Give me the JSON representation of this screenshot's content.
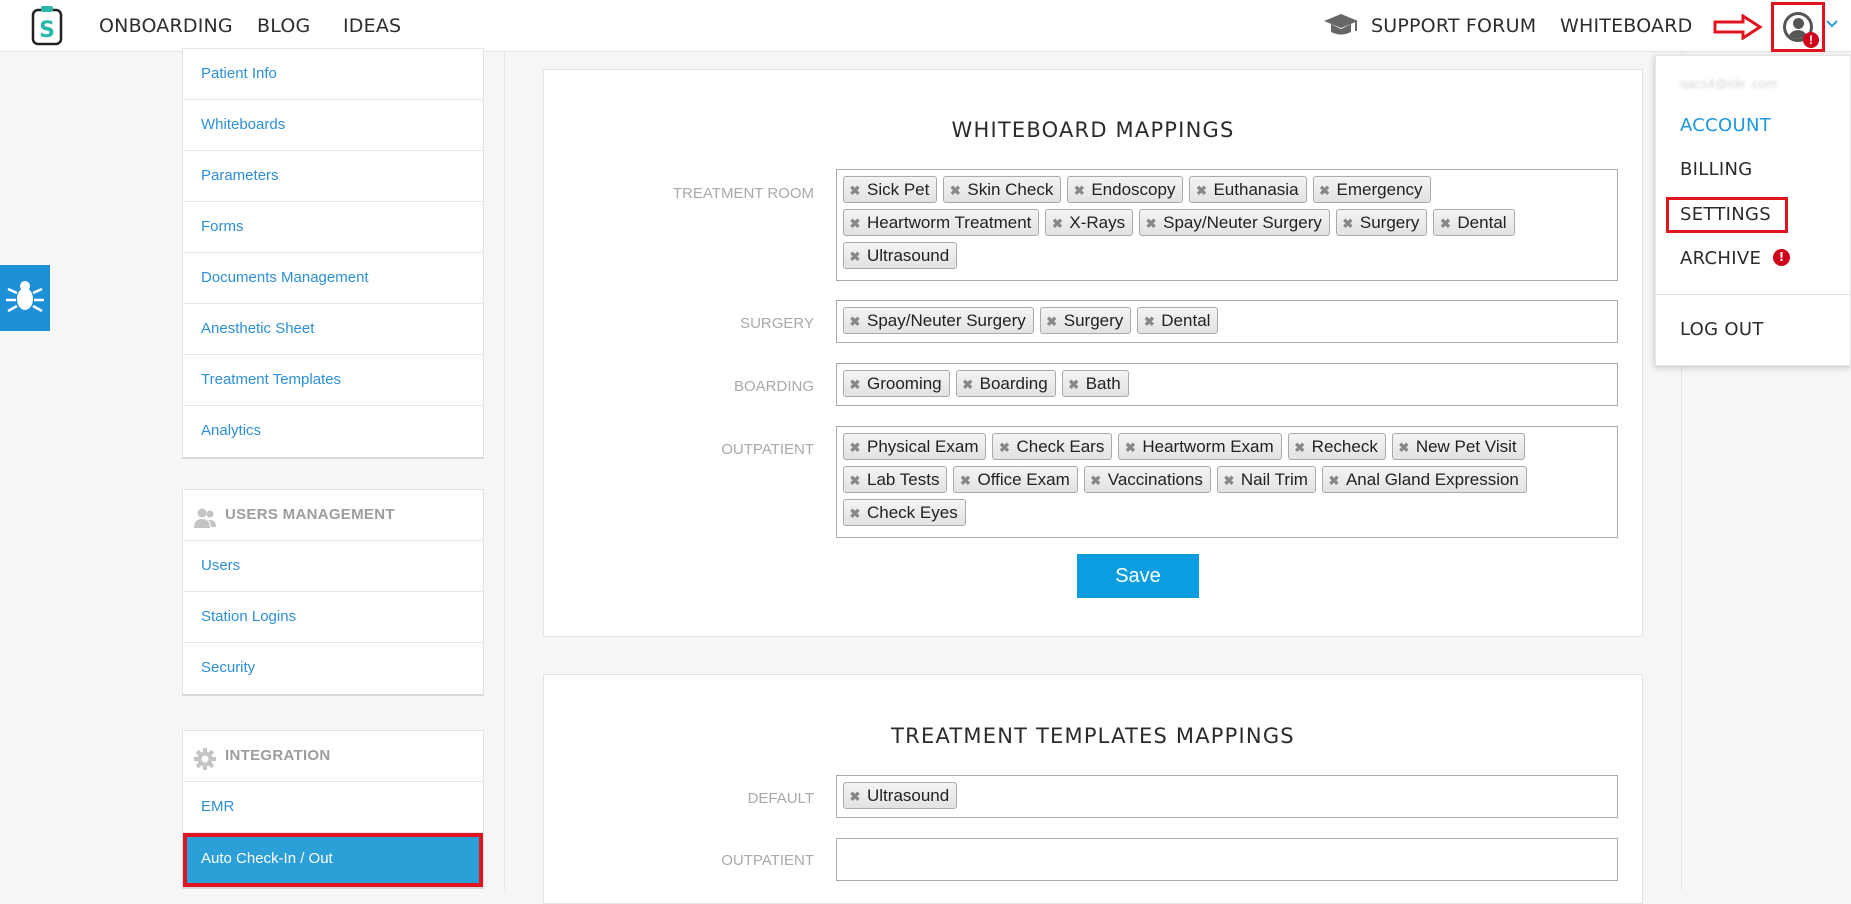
{
  "nav": {
    "onboarding": "ONBOARDING",
    "blog": "BLOG",
    "ideas": "IDEAS",
    "support_forum": "SUPPORT FORUM",
    "whiteboard": "WHITEBOARD"
  },
  "sidebar": {
    "group1": [
      "Patient Info",
      "Whiteboards",
      "Parameters",
      "Forms",
      "Documents Management",
      "Anesthetic Sheet",
      "Treatment Templates",
      "Analytics"
    ],
    "users_heading": "USERS MANAGEMENT",
    "group2": [
      "Users",
      "Station Logins",
      "Security"
    ],
    "integration_heading": "INTEGRATION",
    "group3": [
      "EMR",
      "Auto Check-In / Out"
    ]
  },
  "whiteboard_mappings": {
    "title": "WHITEBOARD MAPPINGS",
    "rows": [
      {
        "label": "TREATMENT ROOM",
        "tags": [
          "Sick Pet",
          "Skin Check",
          "Endoscopy",
          "Euthanasia",
          "Emergency",
          "Heartworm Treatment",
          "X-Rays",
          "Spay/Neuter Surgery",
          "Surgery",
          "Dental",
          "Ultrasound"
        ]
      },
      {
        "label": "SURGERY",
        "tags": [
          "Spay/Neuter Surgery",
          "Surgery",
          "Dental"
        ]
      },
      {
        "label": "BOARDING",
        "tags": [
          "Grooming",
          "Boarding",
          "Bath"
        ]
      },
      {
        "label": "OUTPATIENT",
        "tags": [
          "Physical Exam",
          "Check Ears",
          "Heartworm Exam",
          "Recheck",
          "New Pet Visit",
          "Lab Tests",
          "Office Exam",
          "Vaccinations",
          "Nail Trim",
          "Anal Gland Expression",
          "Check Eyes"
        ]
      }
    ],
    "save_label": "Save"
  },
  "treatment_templates_mappings": {
    "title": "TREATMENT TEMPLATES MAPPINGS",
    "rows": [
      {
        "label": "DEFAULT",
        "tags": [
          "Ultrasound"
        ]
      },
      {
        "label": "OUTPATIENT",
        "tags": []
      }
    ]
  },
  "account_menu": {
    "email": "qacs4@ide .com",
    "account": "ACCOUNT",
    "billing": "BILLING",
    "settings": "SETTINGS",
    "archive": "ARCHIVE",
    "alert_glyph": "!",
    "logout": "LOG OUT"
  },
  "tag_remove_glyph": "✖",
  "colors": {
    "accent": "#1e98dc",
    "active_item": "#2a9fd8",
    "highlight_box": "#e0141e",
    "alert": "#d0021b"
  },
  "icons": [
    "logo-icon",
    "mortarboard-icon",
    "red-arrow-icon",
    "user-avatar-icon",
    "alert-icon",
    "chevron-down-icon",
    "bug-icon",
    "users-icon",
    "gear-icon",
    "tag-remove-icon"
  ]
}
